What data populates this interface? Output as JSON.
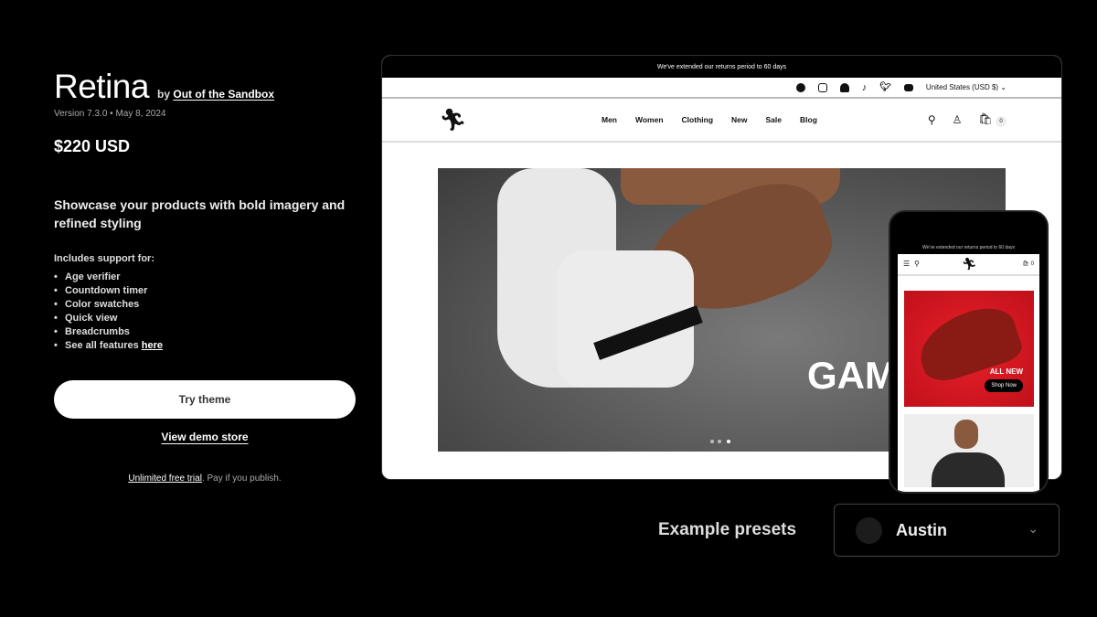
{
  "theme": {
    "title": "Retina",
    "by_prefix": "by",
    "author": "Out of the Sandbox",
    "version": "Version 7.3.0",
    "date": "May 8, 2024",
    "price": "$220 USD",
    "tagline": "Showcase your products with bold imagery and refined styling",
    "includes_label": "Includes support for:",
    "features": [
      "Age verifier",
      "Countdown timer",
      "Color swatches",
      "Quick view",
      "Breadcrumbs"
    ],
    "see_all_prefix": "See all features",
    "see_all_link": "here",
    "try_button": "Try theme",
    "demo_link": "View demo store",
    "trial_link": "Unlimited free trial",
    "trial_suffix": ". Pay if you publish."
  },
  "preview": {
    "announcement": "We've extended our returns period to 60 days",
    "social_icons": [
      "facebook-icon",
      "instagram-icon",
      "snapchat-icon",
      "tiktok-icon",
      "twitter-icon",
      "youtube-icon"
    ],
    "currency": "United States (USD $)",
    "nav": [
      "Men",
      "Women",
      "Clothing",
      "New",
      "Sale",
      "Blog"
    ],
    "cart_count": "0",
    "hero_text": "GAM"
  },
  "mobile": {
    "announcement": "We've extended our returns period to 60 days",
    "cart_count": "0",
    "banner_title": "ALL NEW",
    "banner_button": "Shop Now"
  },
  "presets": {
    "label": "Example presets",
    "selected": "Austin"
  }
}
